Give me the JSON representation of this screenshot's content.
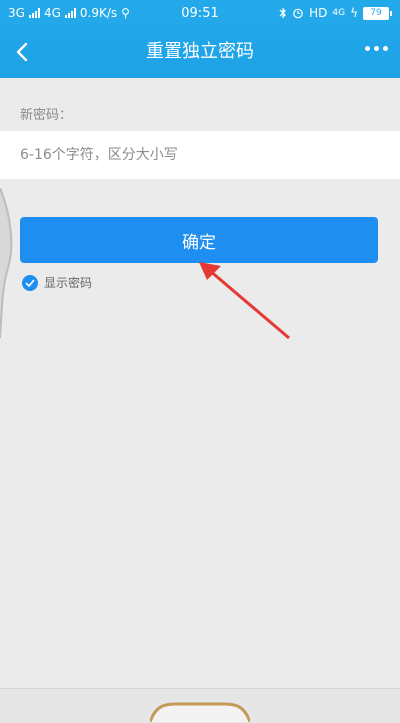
{
  "status_bar": {
    "net1": "3G",
    "net2": "4G",
    "speed": "0.9K/s",
    "time": "09:51",
    "hd": "HD",
    "net_small": "4G",
    "battery": "79"
  },
  "nav": {
    "title": "重置独立密码"
  },
  "form": {
    "label": "新密码：",
    "placeholder": "6-16个字符，区分大小写",
    "value": "",
    "confirm_label": "确定",
    "show_password_label": "显示密码",
    "show_password_checked": true
  },
  "icons": [
    "back-icon",
    "more-icon",
    "check-icon",
    "bluetooth-icon",
    "alarm-icon",
    "battery-icon",
    "annotation-arrow"
  ],
  "colors": {
    "nav_bg": "#20a6ea",
    "button_bg": "#1e8ef0",
    "page_bg": "#ebebeb",
    "arrow": "#e53935"
  }
}
